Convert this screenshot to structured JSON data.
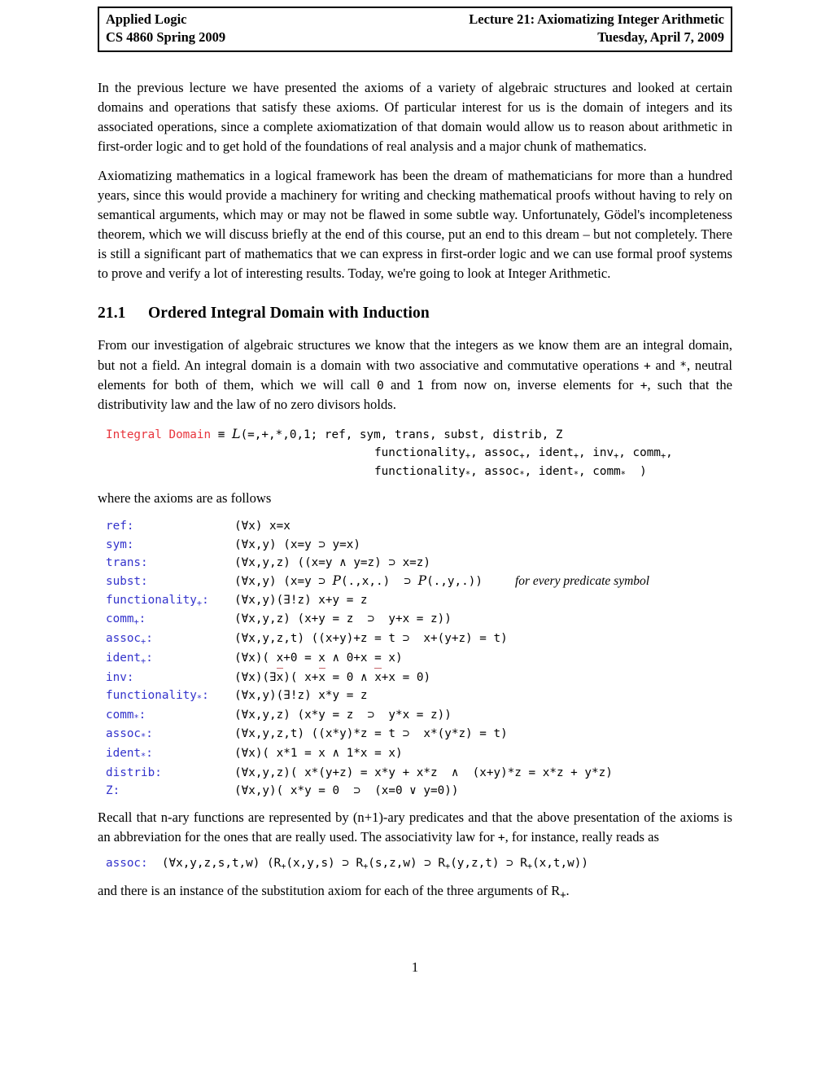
{
  "header": {
    "left_line1": "Applied Logic",
    "left_line2": "CS 4860 Spring 2009",
    "right_line1": "Lecture 21: Axiomatizing Integer Arithmetic",
    "right_line2": "Tuesday, April 7, 2009"
  },
  "colors": {
    "definition_red": "#e8343c",
    "axiom_label_blue": "#3333cc",
    "text_black": "#000000",
    "border_black": "#000000"
  },
  "body": {
    "paragraph1": "In the previous lecture we have presented the axioms of a variety of algebraic structures and looked at certain domains and operations that satisfy these axioms. Of particular interest for us is the domain of integers and its associated operations, since a complete axiomatization of that domain would allow us to reason about arithmetic in first-order logic and to get hold of the foundations of real analysis and a major chunk of mathematics.",
    "paragraph2": "Axiomatizing mathematics in a logical framework has been the dream of mathematicians for more than a hundred years, since this would provide a machinery for writing and checking mathematical proofs without having to rely on semantical arguments, which may or may not be flawed in some subtle way. Unfortunately, Gödel's incompleteness theorem, which we will discuss briefly at the end of this course, put an end to this dream – but not completely. There is still a significant part of mathematics that we can express in first-order logic and we can use formal proof systems to prove and verify a lot of interesting results. Today, we're going to look at Integer Arithmetic."
  },
  "section": {
    "number": "21.1",
    "title": "Ordered Integral Domain with Induction",
    "intro_part1": "From our investigation of algebraic structures we know that the integers as we know them are an integral domain, but not a field. An integral domain is a domain with two associative and commutative operations ",
    "intro_op_plus": "+",
    "intro_part2": " and ",
    "intro_op_times": "*",
    "intro_part3": ", neutral elements for both of them, which we will call ",
    "intro_zero": "0",
    "intro_part4": " and ",
    "intro_one": "1",
    "intro_part5": " from now on, inverse elements for ",
    "intro_op_plus2": "+",
    "intro_part6": ", such that the distributivity law and the law of no zero divisors holds."
  },
  "definition": {
    "name": "Integral Domain",
    "equiv_symbol": "≡",
    "signature_open": "(=,+,*,0,1; ref, sym, trans, subst, distrib, Z",
    "line2_items": [
      "functionality",
      "assoc",
      "ident",
      "inv",
      "comm"
    ],
    "line2_sub": "+",
    "line2_text": "functionality+, assoc+, ident+, inv+, comm+,",
    "line3_items": [
      "functionality",
      "assoc",
      "ident",
      "comm"
    ],
    "line3_sub": "*",
    "line3_text": "functionality*, assoc*, ident*, comm*  )",
    "caption_after": "where the axioms are as follows"
  },
  "axioms": [
    {
      "label": "ref",
      "sub": "",
      "body": "(∀x) x=x",
      "note": ""
    },
    {
      "label": "sym",
      "sub": "",
      "body": "(∀x,y) (x=y ⊃ y=x)",
      "note": ""
    },
    {
      "label": "trans",
      "sub": "",
      "body": "(∀x,y,z) ((x=y ∧ y=z) ⊃ x=z)",
      "note": ""
    },
    {
      "label": "subst",
      "sub": "",
      "body": "(∀x,y) (x=y ⊃ P(.,x,.)  ⊃ P(.,y,.))",
      "note": "for every predicate symbol"
    },
    {
      "label": "functionality",
      "sub": "+",
      "body": "(∀x,y)(∃!z) x+y = z",
      "note": ""
    },
    {
      "label": "comm",
      "sub": "+",
      "body": "(∀x,y,z) (x+y = z  ⊃  y+x = z))",
      "note": ""
    },
    {
      "label": "assoc",
      "sub": "+",
      "body": "(∀x,y,z,t) ((x+y)+z = t ⊃  x+(y+z) = t)",
      "note": ""
    },
    {
      "label": "ident",
      "sub": "+",
      "body": "(∀x)( x+0 = x ∧ 0+x = x)",
      "note": ""
    },
    {
      "label": "inv",
      "sub": "",
      "body": "(∀x)(∃x̄)( x+x̄ = 0 ∧ x̄+x = 0)",
      "note": ""
    },
    {
      "label": "functionality",
      "sub": "*",
      "body": "(∀x,y)(∃!z) x*y = z",
      "note": ""
    },
    {
      "label": "comm",
      "sub": "*",
      "body": "(∀x,y,z) (x*y = z  ⊃  y*x = z))",
      "note": ""
    },
    {
      "label": "assoc",
      "sub": "*",
      "body": "(∀x,y,z,t) ((x*y)*z = t ⊃  x*(y*z) = t)",
      "note": ""
    },
    {
      "label": "ident",
      "sub": "*",
      "body": "(∀x)( x*1 = x ∧ 1*x = x)",
      "note": ""
    },
    {
      "label": "distrib",
      "sub": "",
      "body": "(∀x,y,z)( x*(y+z) = x*y + x*z  ∧  (x+y)*z = x*z + y*z)",
      "note": ""
    },
    {
      "label": "Z",
      "sub": "",
      "body": "(∀x,y)( x*y = 0  ⊃  (x=0 ∨ y=0))",
      "note": ""
    }
  ],
  "closing": {
    "paragraph_part1": "Recall that n-ary functions are represented by (n+1)-ary predicates and that the above presentation of the axioms is an abbreviation for the ones that are really used. The associativity law for ",
    "paragraph_plus": "+",
    "paragraph_part2": ", for instance, really reads as",
    "assoc_label": "assoc:",
    "assoc_body": "(∀x,y,z,s,t,w) (R+(x,y,s) ⊃ R+(s,z,w) ⊃ R+(y,z,t) ⊃ R+(x,t,w))",
    "final_part1": "and there is an instance of the substitution axiom for each of the three arguments of R",
    "final_sub": "+",
    "final_part2": "."
  },
  "page_number": "1"
}
